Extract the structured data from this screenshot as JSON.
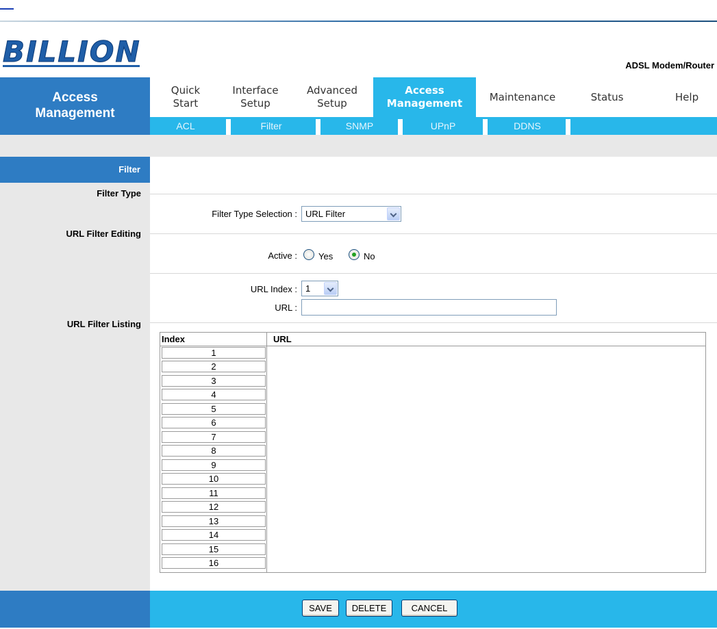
{
  "brand": {
    "logo_text": "BILLION",
    "product": "ADSL Modem/Router"
  },
  "section_title": "Access\nManagement",
  "menu": [
    {
      "label": "Quick\nStart",
      "active": false
    },
    {
      "label": "Interface\nSetup",
      "active": false
    },
    {
      "label": "Advanced\nSetup",
      "active": false
    },
    {
      "label": "Access\nManagement",
      "active": true
    },
    {
      "label": "Maintenance",
      "active": false
    },
    {
      "label": "Status",
      "active": false
    },
    {
      "label": "Help",
      "active": false
    }
  ],
  "submenu": [
    "ACL",
    "Filter",
    "SNMP",
    "UPnP",
    "DDNS"
  ],
  "sidebar": {
    "active": "Filter",
    "filter_type": "Filter Type",
    "url_filter_editing": "URL Filter Editing",
    "url_filter_listing": "URL Filter Listing"
  },
  "form": {
    "filter_type_label": "Filter Type Selection :",
    "filter_type_value": "URL Filter",
    "active_label": "Active :",
    "active_yes": "Yes",
    "active_no": "No",
    "active_value": "No",
    "url_index_label": "URL Index :",
    "url_index_value": "1",
    "url_label": "URL :",
    "url_value": ""
  },
  "listing": {
    "col_index": "Index",
    "col_url": "URL",
    "rows": [
      "1",
      "2",
      "3",
      "4",
      "5",
      "6",
      "7",
      "8",
      "9",
      "10",
      "11",
      "12",
      "13",
      "14",
      "15",
      "16"
    ]
  },
  "buttons": {
    "save": "SAVE",
    "delete": "DELETE",
    "cancel": "CANCEL"
  },
  "colors": {
    "dark_blue": "#2e7cc3",
    "light_blue": "#28b7ea",
    "sidebar_gray": "#e8e8e8"
  }
}
